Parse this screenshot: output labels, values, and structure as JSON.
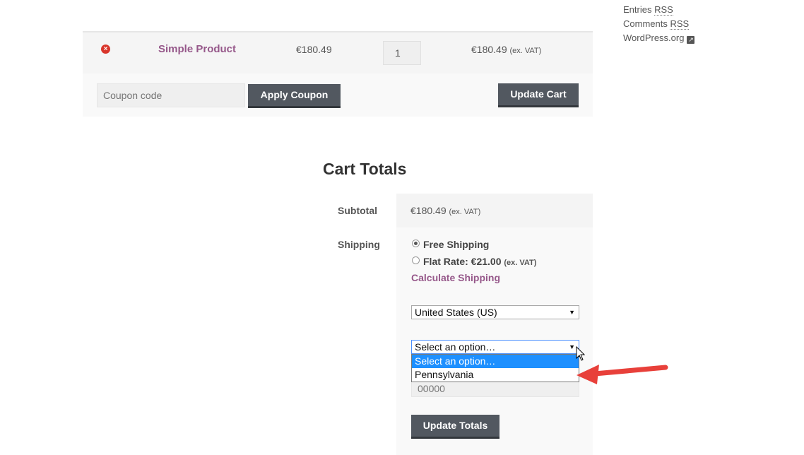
{
  "sidebar": {
    "links": [
      {
        "prefix": "Entries ",
        "abbr": "RSS"
      },
      {
        "prefix": "Comments ",
        "abbr": "RSS"
      },
      {
        "prefix": "WordPress.org",
        "abbr": ""
      }
    ]
  },
  "cart": {
    "item": {
      "remove_icon": "×",
      "name": "Simple Product",
      "price": "€180.49",
      "quantity": "1",
      "total": "€180.49",
      "total_note": "(ex. VAT)"
    },
    "coupon_placeholder": "Coupon code",
    "apply_coupon_label": "Apply Coupon",
    "update_cart_label": "Update Cart"
  },
  "totals": {
    "title": "Cart Totals",
    "subtotal_label": "Subtotal",
    "subtotal_value": "€180.49",
    "subtotal_note": "(ex. VAT)",
    "shipping_label": "Shipping",
    "free_shipping_label": "Free Shipping",
    "flat_rate_label": "Flat Rate: €21.00",
    "flat_rate_note": "(ex. VAT)",
    "calculate_shipping_label": "Calculate Shipping",
    "country_select_value": "United States (US)",
    "state_select_value": "Select an option…",
    "state_options": [
      "Select an option…",
      "Pennsylvania"
    ],
    "postcode_placeholder": "00000",
    "update_totals_label": "Update Totals"
  },
  "colors": {
    "link_purple": "#96588a",
    "button_dark": "#525860",
    "remove_red": "#d9362b",
    "highlight_blue": "#1e90ff",
    "annotation_arrow_red": "#e8403a"
  },
  "icons": {
    "remove": "remove-circle-icon",
    "external": "external-link-icon",
    "dropdown": "chevron-down-icon",
    "cursor": "mouse-pointer-icon",
    "annotation": "red-arrow-annotation-icon"
  }
}
